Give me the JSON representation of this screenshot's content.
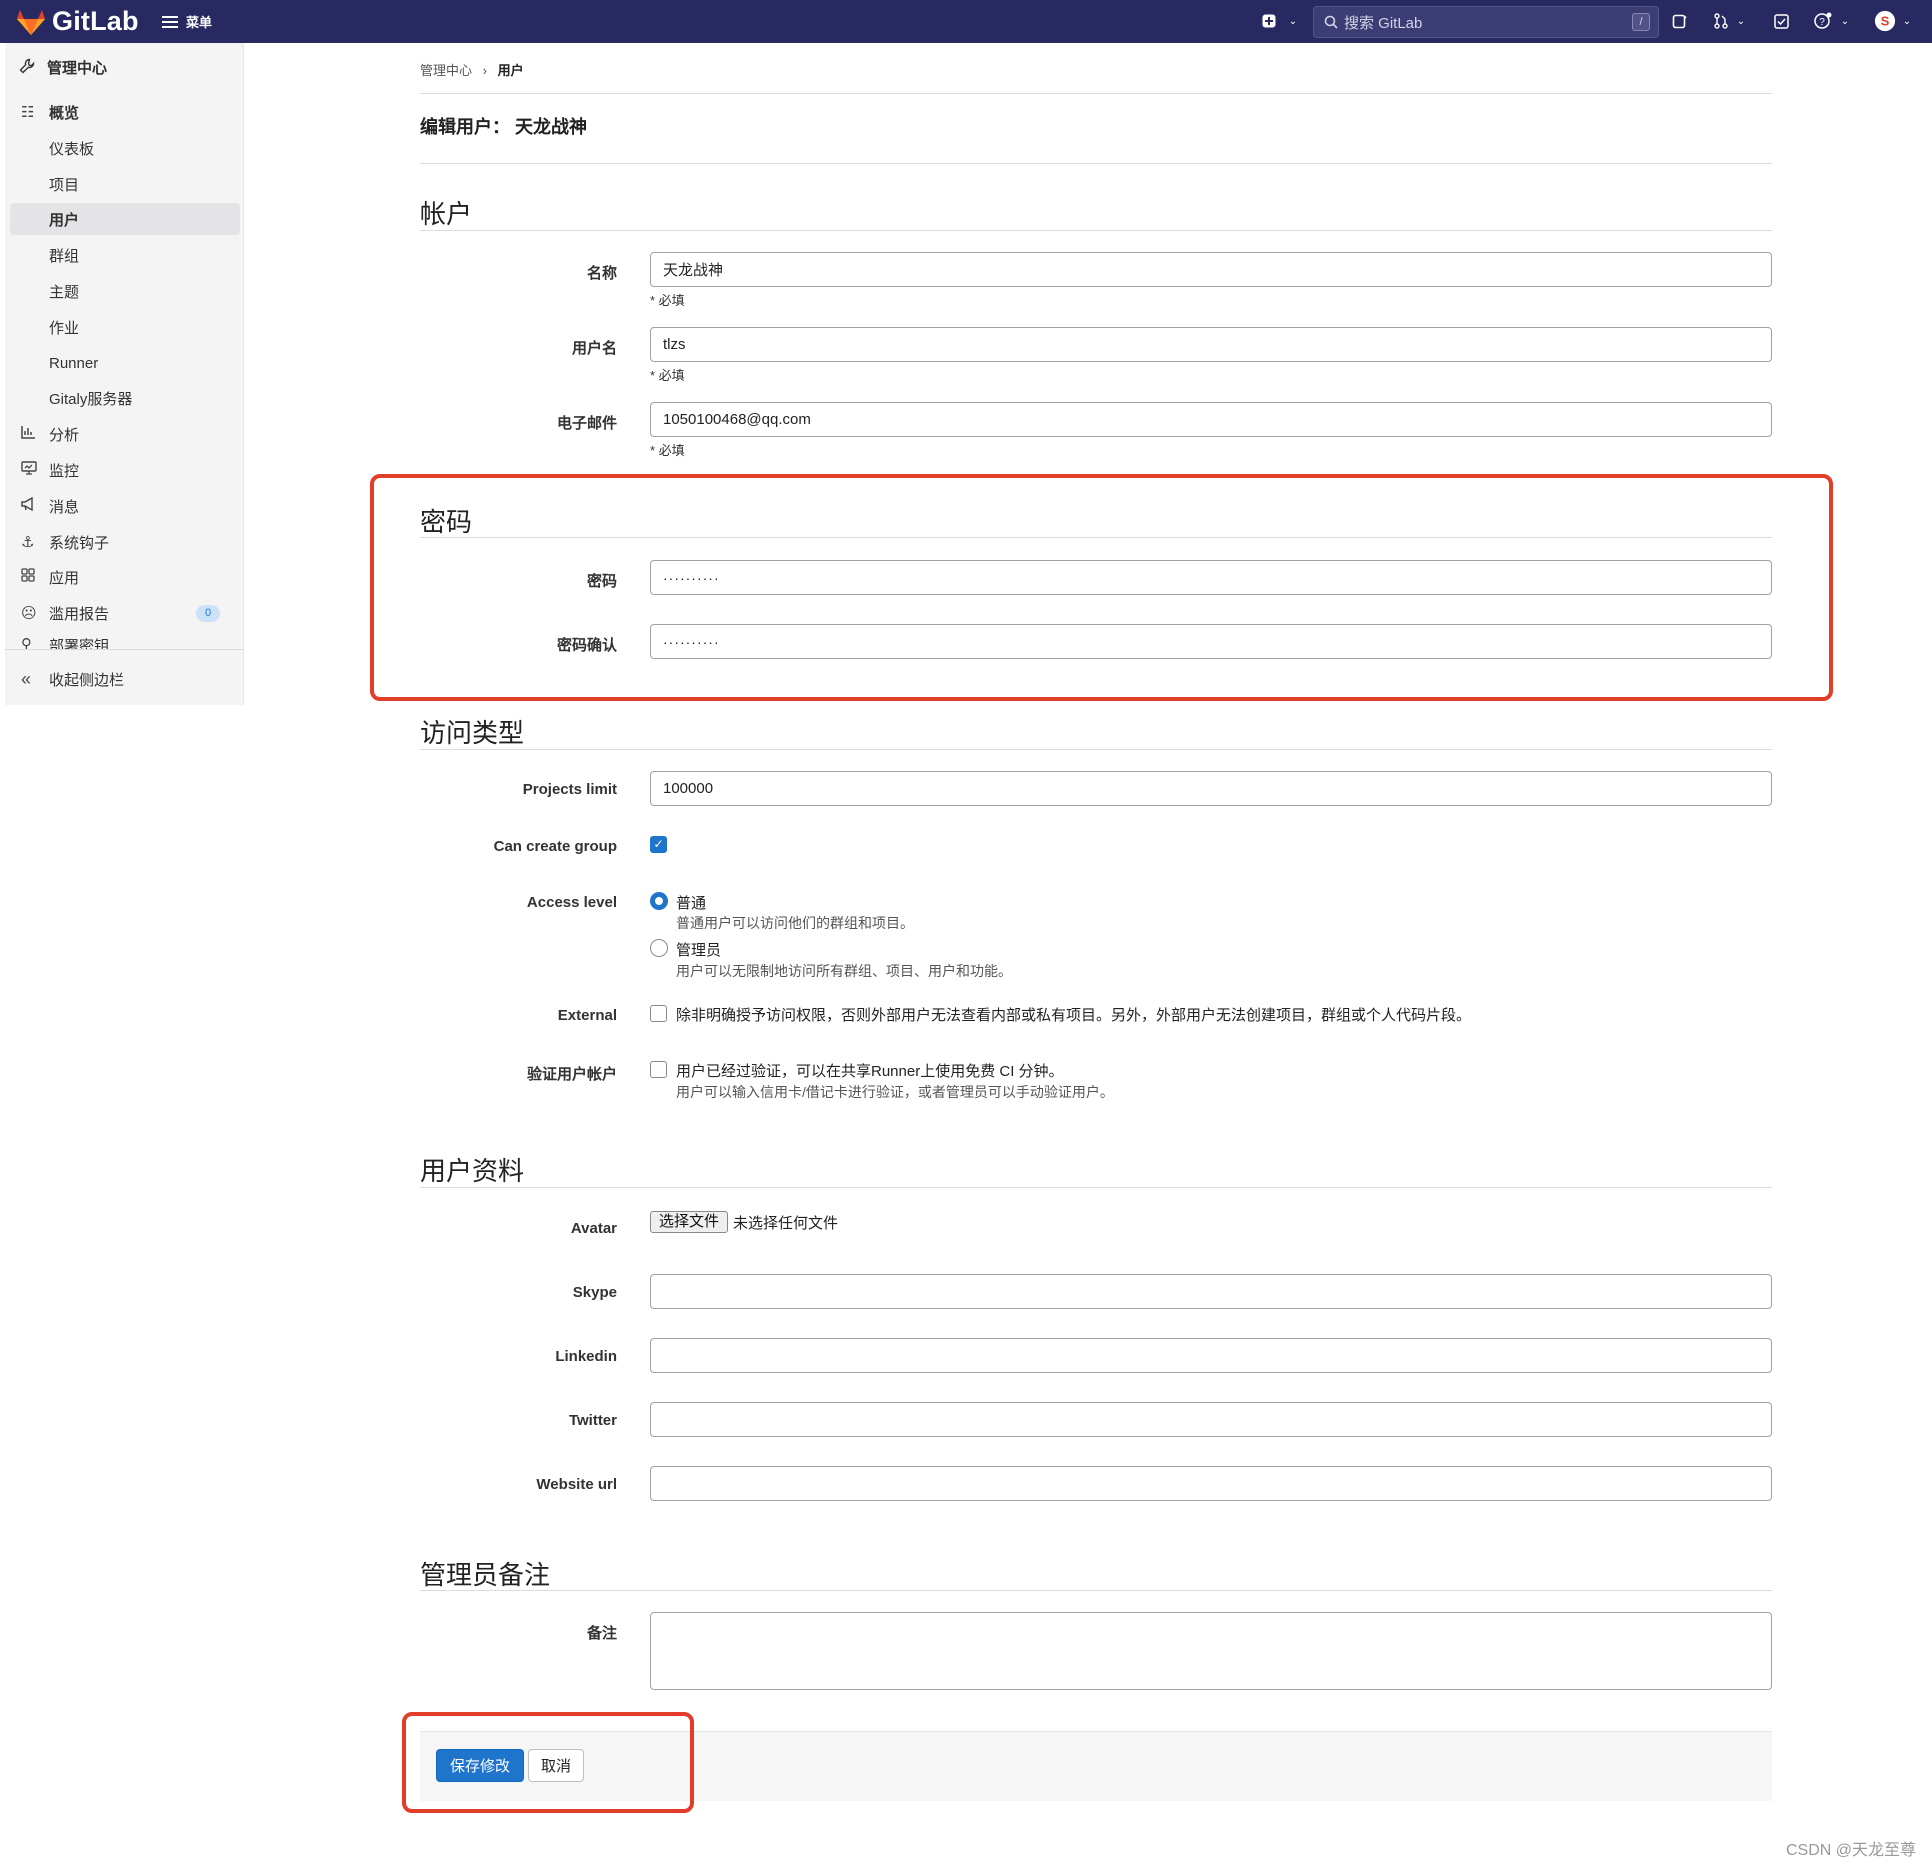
{
  "navbar": {
    "brand": "GitLab",
    "menu_label": "菜单",
    "search_placeholder": "搜索 GitLab",
    "search_shortcut": "/",
    "brand_color": "#292961",
    "accent_color": "#1f75cb"
  },
  "sidebar": {
    "header": "管理中心",
    "items": [
      {
        "label": "概览",
        "icon": "overview-icon"
      },
      {
        "label": "仪表板"
      },
      {
        "label": "项目"
      },
      {
        "label": "用户"
      },
      {
        "label": "群组"
      },
      {
        "label": "主题"
      },
      {
        "label": "作业"
      },
      {
        "label": "Runner"
      },
      {
        "label": "Gitaly服务器"
      },
      {
        "label": "分析",
        "icon": "chart-icon"
      },
      {
        "label": "监控",
        "icon": "monitor-icon"
      },
      {
        "label": "消息",
        "icon": "megaphone-icon"
      },
      {
        "label": "系统钩子",
        "icon": "anchor-icon"
      },
      {
        "label": "应用",
        "icon": "apps-grid-icon"
      },
      {
        "label": "滥用报告",
        "icon": "smiley-icon",
        "badge": "0"
      },
      {
        "label": "部署密钥",
        "icon": "key-icon"
      }
    ],
    "collapse_label": "收起侧边栏"
  },
  "breadcrumb": {
    "parent": "管理中心",
    "separator": "›",
    "current": "用户"
  },
  "page_title": "编辑用户：  天龙战神",
  "account": {
    "title": "帐户",
    "name_label": "名称",
    "name_value": "天龙战神",
    "username_label": "用户名",
    "username_value": "tlzs",
    "email_label": "电子邮件",
    "email_value": "1050100468@qq.com",
    "required_note": "* 必填"
  },
  "password": {
    "title": "密码",
    "password_label": "密码",
    "password_value": "··········",
    "confirm_label": "密码确认",
    "confirm_value": "··········"
  },
  "access": {
    "title": "访问类型",
    "projects_limit_label": "Projects limit",
    "projects_limit_value": "100000",
    "can_create_group_label": "Can create group",
    "can_create_group_checked": true,
    "access_level_label": "Access level",
    "regular_label": "普通",
    "regular_help": "普通用户可以访问他们的群组和项目。",
    "admin_label": "管理员",
    "admin_help": "用户可以无限制地访问所有群组、项目、用户和功能。",
    "selected_level": "普通",
    "external_label": "External",
    "external_text": "除非明确授予访问权限，否则外部用户无法查看内部或私有项目。另外，外部用户无法创建项目，群组或个人代码片段。",
    "verify_label": "验证用户帐户",
    "verify_text": "用户已经过验证，可以在共享Runner上使用免费 CI 分钟。",
    "verify_help": "用户可以输入信用卡/借记卡进行验证，或者管理员可以手动验证用户。"
  },
  "profile": {
    "title": "用户资料",
    "avatar_label": "Avatar",
    "file_button": "选择文件",
    "file_status": "未选择任何文件",
    "skype_label": "Skype",
    "linkedin_label": "Linkedin",
    "twitter_label": "Twitter",
    "website_label": "Website url"
  },
  "admin_notes": {
    "title": "管理员备注",
    "note_label": "备注"
  },
  "actions": {
    "save": "保存修改",
    "cancel": "取消"
  },
  "watermark": "CSDN @天龙至尊",
  "annotation_color": "#e23d28"
}
